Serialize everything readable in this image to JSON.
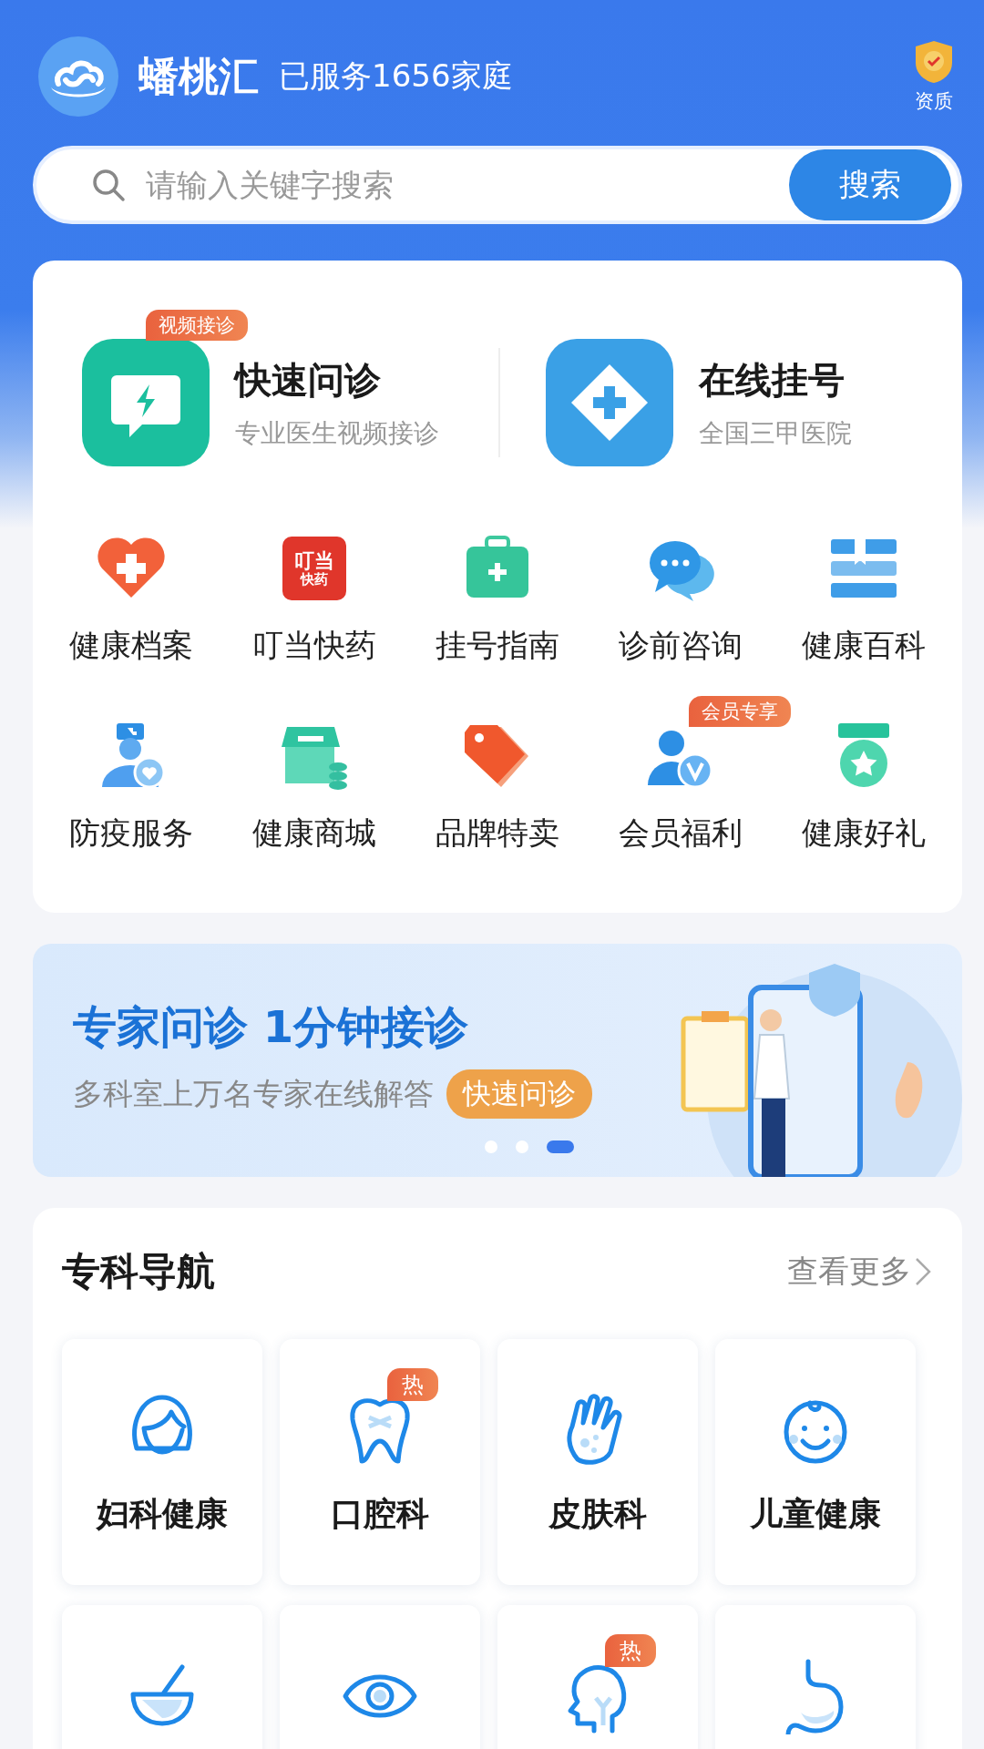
{
  "header": {
    "app_name": "蟠桃汇",
    "tagline": "已服务1656家庭",
    "qualification": "资质"
  },
  "search": {
    "placeholder": "请输入关键字搜索",
    "button": "搜索"
  },
  "quick_services": [
    {
      "title": "快速问诊",
      "subtitle": "专业医生视频接诊",
      "badge": "视频接诊"
    },
    {
      "title": "在线挂号",
      "subtitle": "全国三甲医院"
    }
  ],
  "shortcuts": [
    {
      "label": "健康档案"
    },
    {
      "label": "叮当快药",
      "icon_text": [
        "叮当",
        "快药"
      ]
    },
    {
      "label": "挂号指南"
    },
    {
      "label": "诊前咨询"
    },
    {
      "label": "健康百科"
    },
    {
      "label": "防疫服务"
    },
    {
      "label": "健康商城"
    },
    {
      "label": "品牌特卖"
    },
    {
      "label": "会员福利",
      "badge": "会员专享"
    },
    {
      "label": "健康好礼"
    }
  ],
  "banner": {
    "title": "专家问诊 1分钟接诊",
    "subtitle": "多科室上万名专家在线解答",
    "button": "快速问诊",
    "dots": [
      {
        "selected": false
      },
      {
        "selected": false
      },
      {
        "selected": true
      }
    ]
  },
  "specialties": {
    "title": "专科导航",
    "more": "查看更多",
    "items": [
      {
        "kind": "full",
        "label": "妇科健康"
      },
      {
        "kind": "full",
        "label": "口腔科",
        "badge": "热"
      },
      {
        "kind": "full",
        "label": "皮肤科"
      },
      {
        "kind": "full",
        "label": "儿童健康"
      },
      {
        "kind": "cut_off"
      },
      {
        "kind": "cut_off"
      },
      {
        "kind": "cut_off",
        "badge": "热"
      },
      {
        "kind": "cut_off"
      }
    ]
  }
}
